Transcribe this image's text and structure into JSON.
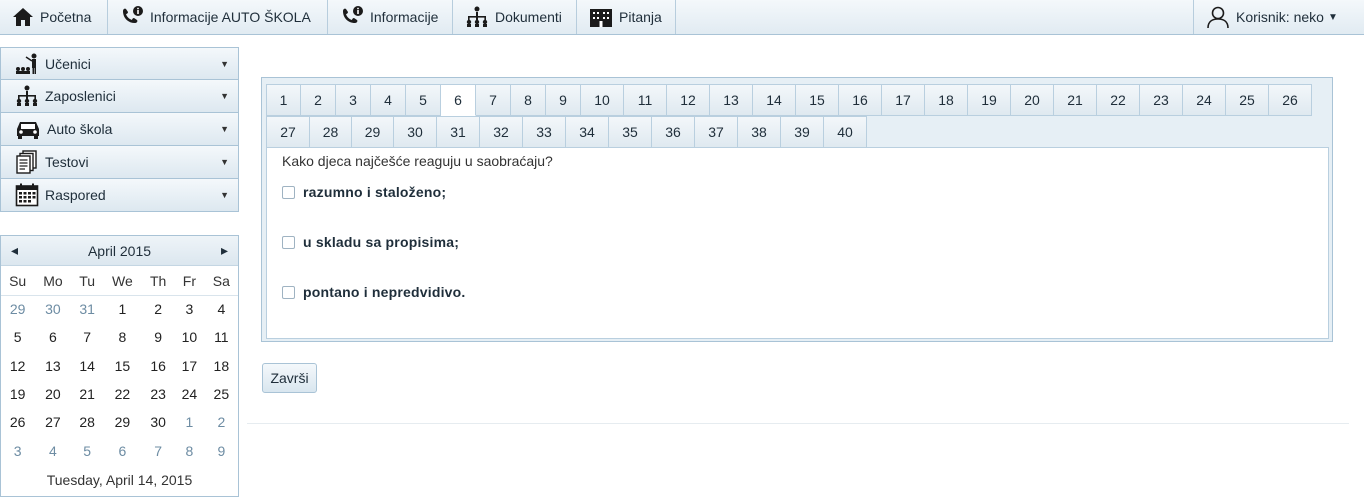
{
  "topnav": {
    "home": "Početna",
    "info_school": "Informacije AUTO ŠKOLA",
    "info": "Informacije",
    "documents": "Dokumenti",
    "questions": "Pitanja",
    "user": "Korisnik: neko"
  },
  "sidebar": {
    "items": [
      {
        "label": "Učenici",
        "icon": "students-icon"
      },
      {
        "label": "Zaposlenici",
        "icon": "org-chart-icon"
      },
      {
        "label": "Auto škola",
        "icon": "car-icon"
      },
      {
        "label": "Testovi",
        "icon": "tests-icon"
      },
      {
        "label": "Raspored",
        "icon": "calendar-icon"
      }
    ]
  },
  "calendar": {
    "month": "April 2015",
    "prev": "◂",
    "next": "▸",
    "weekdays": [
      "Su",
      "Mo",
      "Tu",
      "We",
      "Th",
      "Fr",
      "Sa"
    ],
    "weeks": [
      [
        [
          "29",
          1
        ],
        [
          "30",
          1
        ],
        [
          "31",
          1
        ],
        [
          "1",
          0
        ],
        [
          "2",
          0
        ],
        [
          "3",
          0
        ],
        [
          "4",
          0
        ]
      ],
      [
        [
          "5",
          0
        ],
        [
          "6",
          0
        ],
        [
          "7",
          0
        ],
        [
          "8",
          0
        ],
        [
          "9",
          0
        ],
        [
          "10",
          0
        ],
        [
          "11",
          0
        ]
      ],
      [
        [
          "12",
          0
        ],
        [
          "13",
          0
        ],
        [
          "14",
          0
        ],
        [
          "15",
          0
        ],
        [
          "16",
          0
        ],
        [
          "17",
          0
        ],
        [
          "18",
          0
        ]
      ],
      [
        [
          "19",
          0
        ],
        [
          "20",
          0
        ],
        [
          "21",
          0
        ],
        [
          "22",
          0
        ],
        [
          "23",
          0
        ],
        [
          "24",
          0
        ],
        [
          "25",
          0
        ]
      ],
      [
        [
          "26",
          0
        ],
        [
          "27",
          0
        ],
        [
          "28",
          0
        ],
        [
          "29",
          0
        ],
        [
          "30",
          0
        ],
        [
          "1",
          1
        ],
        [
          "2",
          1
        ]
      ],
      [
        [
          "3",
          1
        ],
        [
          "4",
          1
        ],
        [
          "5",
          1
        ],
        [
          "6",
          1
        ],
        [
          "7",
          1
        ],
        [
          "8",
          1
        ],
        [
          "9",
          1
        ]
      ]
    ],
    "footer": "Tuesday, April 14, 2015"
  },
  "quiz": {
    "tabs_row1": [
      "1",
      "2",
      "3",
      "4",
      "5",
      "6",
      "7",
      "8",
      "9",
      "10",
      "11",
      "12",
      "13",
      "14",
      "15",
      "16",
      "17",
      "18",
      "19",
      "20",
      "21",
      "22",
      "23",
      "24",
      "25",
      "26"
    ],
    "tabs_row2": [
      "27",
      "28",
      "29",
      "30",
      "31",
      "32",
      "33",
      "34",
      "35",
      "36",
      "37",
      "38",
      "39",
      "40"
    ],
    "active_tab": "6",
    "question": "Kako djeca najčešće reaguju u saobraćaju?",
    "answers": [
      "razumno i staloženo;",
      "u skladu sa propisima;",
      "pontano i nepredvidivo."
    ],
    "finish": "Završi"
  },
  "colors": {
    "accent_border": "#a9c3d6",
    "panel_bg": "#e6eff5",
    "muted_day": "#6d8ca3"
  }
}
